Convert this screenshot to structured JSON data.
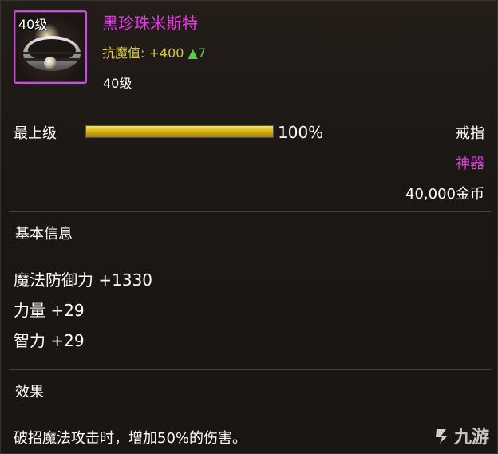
{
  "item": {
    "icon_level": "40级",
    "name": "黑珍珠米斯特",
    "resist_label": "抗魔值:",
    "resist_value": "+400",
    "resist_delta": "▲7",
    "required_level": "40级"
  },
  "upgrade": {
    "label": "最上级",
    "percent_text": "100%",
    "fraction": 1.0
  },
  "meta": {
    "type": "戒指",
    "grade": "神器",
    "price": "40,000金币"
  },
  "basic_info": {
    "title": "基本信息",
    "stats": [
      "魔法防御力 +1330",
      "力量 +29",
      "智力 +29"
    ]
  },
  "effect": {
    "title": "效果",
    "text": "破招魔法攻击时，增加50%的伤害。"
  },
  "watermark": {
    "text": "九游"
  },
  "colors": {
    "name": "#e63ae6",
    "resist": "#d7c552",
    "delta": "#55d145",
    "bar": "#d9b417",
    "border": "#c552d4"
  }
}
